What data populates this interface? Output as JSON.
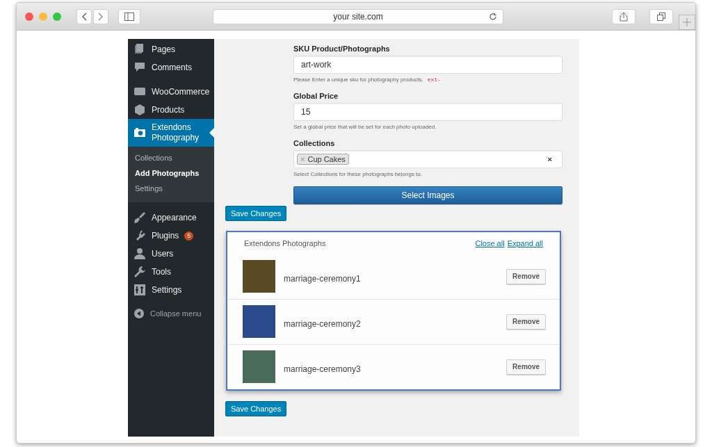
{
  "browser": {
    "address": "your site.com"
  },
  "sidebar": {
    "groups": [
      [
        {
          "label": "Pages",
          "selected": false
        },
        {
          "label": "Comments",
          "selected": false
        }
      ],
      [
        {
          "label": "WooCommerce",
          "selected": false
        },
        {
          "label": "Products",
          "selected": false
        },
        {
          "label": "Extendons Photography",
          "selected": true,
          "children": [
            {
              "label": "Collections",
              "selected": false
            },
            {
              "label": "Add Photographs",
              "selected": true
            },
            {
              "label": "Settings",
              "selected": false
            }
          ]
        }
      ],
      [
        {
          "label": "Appearance",
          "selected": false
        },
        {
          "label": "Plugins",
          "selected": false,
          "badge": "5"
        },
        {
          "label": "Users",
          "selected": false
        },
        {
          "label": "Tools",
          "selected": false
        },
        {
          "label": "Settings",
          "selected": false
        }
      ]
    ],
    "collapse": "Collapse menu"
  },
  "form": {
    "fields": [
      {
        "kind": "text",
        "label": "SKU Product/Photographs",
        "value": "art-work",
        "help": "Please Enter a unique sku for photography products.",
        "code": "ext-"
      },
      {
        "kind": "text",
        "label": "Global Price",
        "value": "15",
        "help": "Set a global price that will be set for each photo uploaded."
      },
      {
        "kind": "tags",
        "label": "Collections",
        "tags": [
          {
            "remove": "×",
            "label": "Cup Cakes"
          }
        ],
        "clear": "×",
        "help": "Select Collections for these photographs belongs to."
      }
    ],
    "select_button": "Select Images",
    "save_button": "Save Changes"
  },
  "photos": {
    "title": "Extendons Photographs",
    "links": [
      "Close all",
      "Expand all"
    ],
    "items": [
      {
        "name": "marriage-ceremony1",
        "button": "Remove"
      },
      {
        "name": "marriage-ceremony2",
        "button": "Remove"
      },
      {
        "name": "marriage-ceremony3",
        "button": "Remove"
      }
    ]
  },
  "save_button": "Save Changes"
}
